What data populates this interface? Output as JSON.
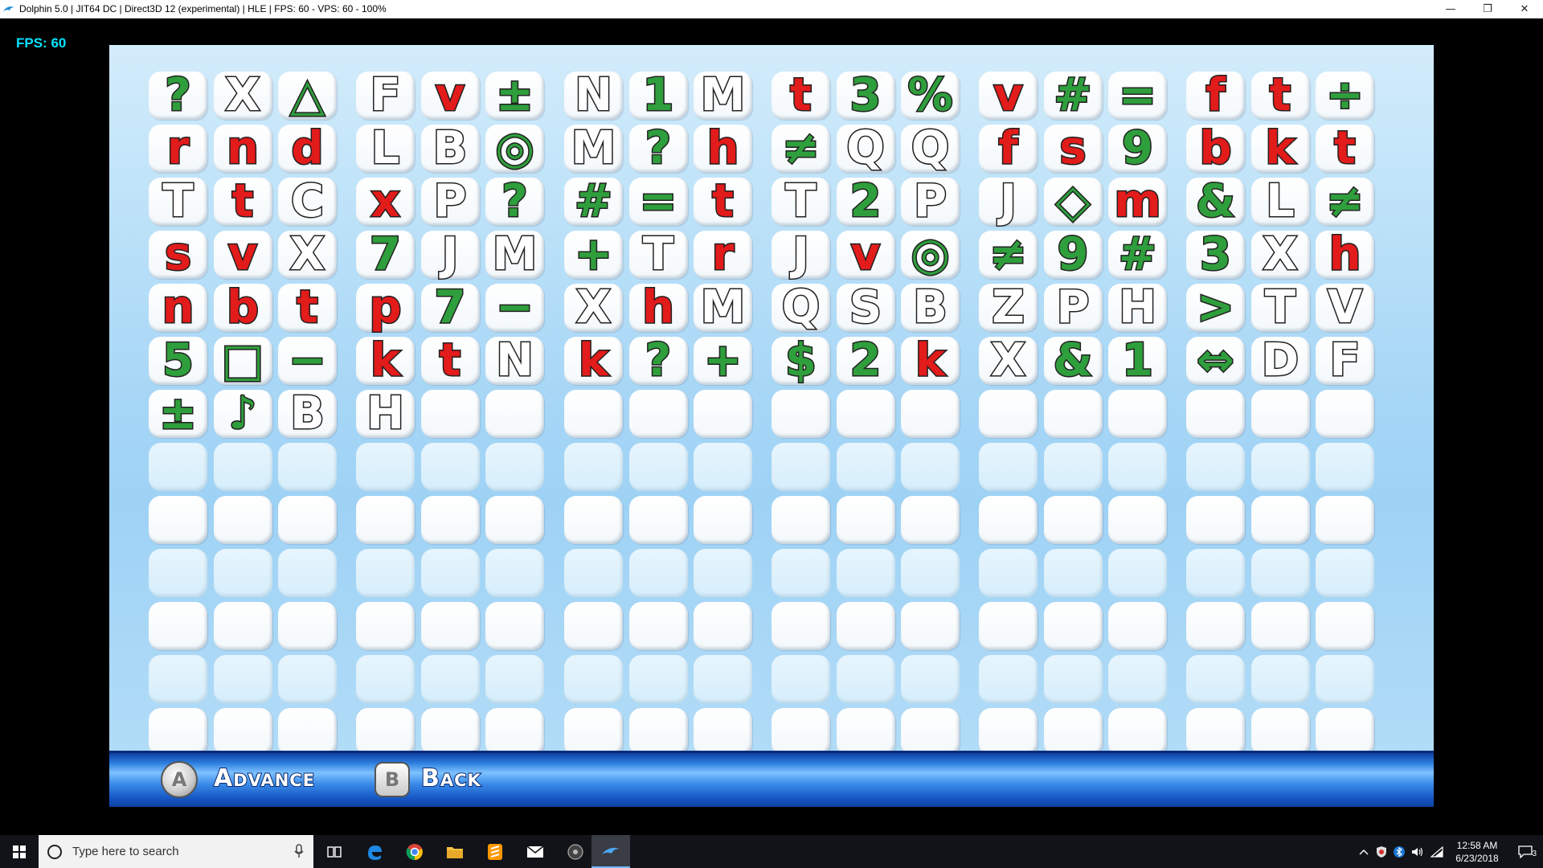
{
  "window": {
    "title": "Dolphin 5.0 | JIT64 DC | Direct3D 12 (experimental) | HLE | FPS: 60 - VPS: 60 - 100%",
    "minimize": "—",
    "restore": "❐",
    "close": "✕"
  },
  "overlay": {
    "fps_label": "FPS: 60"
  },
  "grid": {
    "rows": [
      [
        [
          "?",
          "green"
        ],
        [
          "X",
          "black"
        ],
        [
          "△",
          "green"
        ],
        [
          "F",
          "black"
        ],
        [
          "v",
          "red"
        ],
        [
          "±",
          "green"
        ],
        [
          "N",
          "black"
        ],
        [
          "1",
          "green"
        ],
        [
          "M",
          "black"
        ],
        [
          "t",
          "red"
        ],
        [
          "3",
          "green"
        ],
        [
          "%",
          "green"
        ],
        [
          "v",
          "red"
        ],
        [
          "#",
          "green"
        ],
        [
          "=",
          "green"
        ],
        [
          "f",
          "red"
        ],
        [
          "t",
          "red"
        ],
        [
          "÷",
          "green"
        ]
      ],
      [
        [
          "r",
          "red"
        ],
        [
          "n",
          "red"
        ],
        [
          "d",
          "red"
        ],
        [
          "L",
          "black"
        ],
        [
          "B",
          "black"
        ],
        [
          "◎",
          "green"
        ],
        [
          "M",
          "black"
        ],
        [
          "?",
          "green"
        ],
        [
          "h",
          "red"
        ],
        [
          "≠",
          "green"
        ],
        [
          "Q",
          "black"
        ],
        [
          "Q",
          "black"
        ],
        [
          "f",
          "red"
        ],
        [
          "s",
          "red"
        ],
        [
          "9",
          "green"
        ],
        [
          "b",
          "red"
        ],
        [
          "k",
          "red"
        ],
        [
          "t",
          "red"
        ]
      ],
      [
        [
          "T",
          "black"
        ],
        [
          "t",
          "red"
        ],
        [
          "C",
          "black"
        ],
        [
          "x",
          "red"
        ],
        [
          "P",
          "black"
        ],
        [
          "?",
          "green"
        ],
        [
          "#",
          "green"
        ],
        [
          "=",
          "green"
        ],
        [
          "t",
          "red"
        ],
        [
          "T",
          "black"
        ],
        [
          "2",
          "green"
        ],
        [
          "P",
          "black"
        ],
        [
          "J",
          "black"
        ],
        [
          "◇",
          "green"
        ],
        [
          "m",
          "red"
        ],
        [
          "&",
          "green"
        ],
        [
          "L",
          "black"
        ],
        [
          "≠",
          "green"
        ]
      ],
      [
        [
          "s",
          "red"
        ],
        [
          "v",
          "red"
        ],
        [
          "X",
          "black"
        ],
        [
          "7",
          "green"
        ],
        [
          "J",
          "black"
        ],
        [
          "M",
          "black"
        ],
        [
          "+",
          "green"
        ],
        [
          "T",
          "black"
        ],
        [
          "r",
          "red"
        ],
        [
          "J",
          "black"
        ],
        [
          "v",
          "red"
        ],
        [
          "◎",
          "green"
        ],
        [
          "≠",
          "green"
        ],
        [
          "9",
          "green"
        ],
        [
          "#",
          "green"
        ],
        [
          "3",
          "green"
        ],
        [
          "X",
          "black"
        ],
        [
          "h",
          "red"
        ]
      ],
      [
        [
          "n",
          "red"
        ],
        [
          "b",
          "red"
        ],
        [
          "t",
          "red"
        ],
        [
          "p",
          "red"
        ],
        [
          "7",
          "green"
        ],
        [
          "−",
          "green"
        ],
        [
          "X",
          "black"
        ],
        [
          "h",
          "red"
        ],
        [
          "M",
          "black"
        ],
        [
          "Q",
          "black"
        ],
        [
          "S",
          "black"
        ],
        [
          "B",
          "black"
        ],
        [
          "Z",
          "black"
        ],
        [
          "P",
          "black"
        ],
        [
          "H",
          "black"
        ],
        [
          ">",
          "green"
        ],
        [
          "T",
          "black"
        ],
        [
          "V",
          "black"
        ]
      ],
      [
        [
          "5",
          "green"
        ],
        [
          "□",
          "green"
        ],
        [
          "−",
          "green"
        ],
        [
          "k",
          "red"
        ],
        [
          "t",
          "red"
        ],
        [
          "N",
          "black"
        ],
        [
          "k",
          "red"
        ],
        [
          "?",
          "green"
        ],
        [
          "+",
          "green"
        ],
        [
          "$",
          "green"
        ],
        [
          "2",
          "green"
        ],
        [
          "k",
          "red"
        ],
        [
          "X",
          "black"
        ],
        [
          "&",
          "green"
        ],
        [
          "1",
          "green"
        ],
        [
          "⇔",
          "green"
        ],
        [
          "D",
          "black"
        ],
        [
          "F",
          "black"
        ]
      ],
      [
        [
          "±",
          "green"
        ],
        [
          "♪",
          "green"
        ],
        [
          "B",
          "black"
        ],
        [
          "H",
          "black"
        ]
      ],
      [],
      [],
      [],
      [],
      [],
      []
    ]
  },
  "bottom_bar": {
    "a_key": "A",
    "a_label": "Advance",
    "b_key": "B",
    "b_label": "Back"
  },
  "taskbar": {
    "search_placeholder": "Type here to search",
    "time": "12:58 AM",
    "date": "6/23/2018",
    "notifications": "3"
  }
}
